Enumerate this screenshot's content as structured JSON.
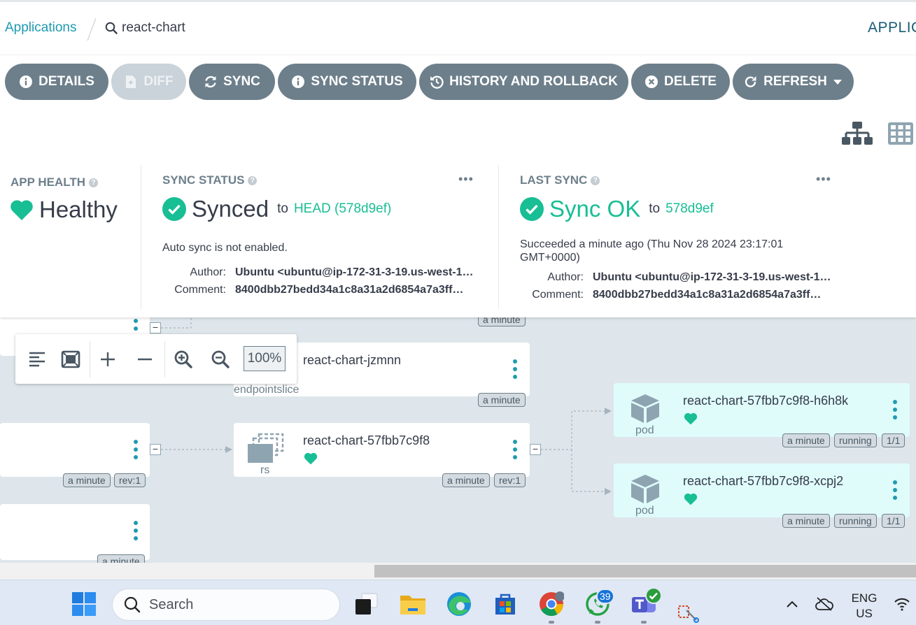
{
  "breadcrumb": {
    "applications": "Applications",
    "current": "react-chart",
    "right_label": "APPLIC"
  },
  "toolbar": {
    "details": "DETAILS",
    "diff": "DIFF",
    "sync": "SYNC",
    "sync_status": "SYNC STATUS",
    "history": "HISTORY AND ROLLBACK",
    "delete": "DELETE",
    "refresh": "REFRESH"
  },
  "app_health": {
    "title": "APP HEALTH",
    "status": "Healthy",
    "color": "#18be94"
  },
  "sync_status": {
    "title": "SYNC STATUS",
    "status": "Synced",
    "to": "to",
    "target": "HEAD (578d9ef)",
    "note": "Auto sync is not enabled.",
    "author_label": "Author:",
    "author": "Ubuntu <ubuntu@ip-172-31-3-19.us-west-1…",
    "comment_label": "Comment:",
    "comment": "8400dbb27bedd34a1c8a31a2d6854a7a3ff…",
    "more": "•••"
  },
  "last_sync": {
    "title": "LAST SYNC",
    "status": "Sync OK",
    "to": "to",
    "revision": "578d9ef",
    "succeeded": "Succeeded a minute ago (Thu Nov 28 2024 23:17:01 GMT+0000)",
    "author_label": "Author:",
    "author": "Ubuntu <ubuntu@ip-172-31-3-19.us-west-1…",
    "comment_label": "Comment:",
    "comment": "8400dbb27bedd34a1c8a31a2d6854a7a3ff…",
    "more": "•••"
  },
  "zoom": {
    "level": "100%"
  },
  "graph": {
    "top_tag": "a minute",
    "endpointslice": {
      "name": "react-chart-jzmnn",
      "kind": "endpointslice",
      "age": "a minute"
    },
    "left_node_1": {
      "age": "a minute",
      "rev": "rev:1"
    },
    "left_node_2": {
      "age": "a minute"
    },
    "replicaset": {
      "name": "react-chart-57fbb7c9f8",
      "kind": "rs",
      "age": "a minute",
      "rev": "rev:1"
    },
    "pods": [
      {
        "name": "react-chart-57fbb7c9f8-h6h8k",
        "kind": "pod",
        "age": "a minute",
        "status": "running",
        "ready": "1/1"
      },
      {
        "name": "react-chart-57fbb7c9f8-xcpj2",
        "kind": "pod",
        "age": "a minute",
        "status": "running",
        "ready": "1/1"
      }
    ]
  },
  "taskbar": {
    "search_placeholder": "Search",
    "whatsapp_badge": "39",
    "lang_line1": "ENG",
    "lang_line2": "US"
  },
  "colors": {
    "accent": "#1f9ab0",
    "button": "#6d7f8b",
    "healthy": "#18be94",
    "graph_bg": "#dee6eb",
    "pod_bg": "#dffcfb"
  }
}
